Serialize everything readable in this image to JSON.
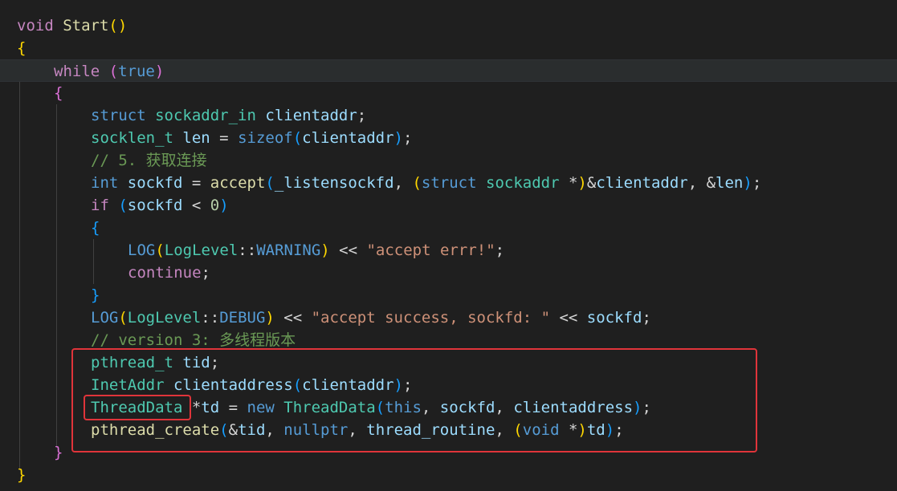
{
  "editor": {
    "theme_colors": {
      "background": "#1f1f1f",
      "current_line": "#2a2d2e",
      "highlight_box": "#e0343a"
    },
    "lines": [
      {
        "indent": 0,
        "tokens": [
          {
            "t": "void",
            "c": "control"
          },
          {
            "t": " ",
            "c": "plain"
          },
          {
            "t": "Start",
            "c": "func"
          },
          {
            "t": "()",
            "c": "brace1"
          }
        ]
      },
      {
        "indent": 0,
        "tokens": [
          {
            "t": "{",
            "c": "brace1"
          }
        ]
      },
      {
        "indent": 1,
        "current": true,
        "tokens": [
          {
            "t": "while",
            "c": "control"
          },
          {
            "t": " ",
            "c": "plain"
          },
          {
            "t": "(",
            "c": "brace2"
          },
          {
            "t": "true",
            "c": "keyword"
          },
          {
            "t": ")",
            "c": "brace2"
          }
        ]
      },
      {
        "indent": 1,
        "tokens": [
          {
            "t": "{",
            "c": "brace2"
          }
        ]
      },
      {
        "indent": 2,
        "tokens": [
          {
            "t": "struct",
            "c": "keyword"
          },
          {
            "t": " ",
            "c": "plain"
          },
          {
            "t": "sockaddr_in",
            "c": "type"
          },
          {
            "t": " ",
            "c": "plain"
          },
          {
            "t": "clientaddr",
            "c": "var"
          },
          {
            "t": ";",
            "c": "plain"
          }
        ]
      },
      {
        "indent": 2,
        "tokens": [
          {
            "t": "socklen_t",
            "c": "type"
          },
          {
            "t": " ",
            "c": "plain"
          },
          {
            "t": "len",
            "c": "var"
          },
          {
            "t": " = ",
            "c": "plain"
          },
          {
            "t": "sizeof",
            "c": "keyword"
          },
          {
            "t": "(",
            "c": "brace3"
          },
          {
            "t": "clientaddr",
            "c": "var"
          },
          {
            "t": ")",
            "c": "brace3"
          },
          {
            "t": ";",
            "c": "plain"
          }
        ]
      },
      {
        "indent": 2,
        "tokens": [
          {
            "t": "// 5. 获取连接",
            "c": "comment"
          }
        ]
      },
      {
        "indent": 2,
        "tokens": [
          {
            "t": "int",
            "c": "keyword"
          },
          {
            "t": " ",
            "c": "plain"
          },
          {
            "t": "sockfd",
            "c": "var"
          },
          {
            "t": " = ",
            "c": "plain"
          },
          {
            "t": "accept",
            "c": "func"
          },
          {
            "t": "(",
            "c": "brace3"
          },
          {
            "t": "_listensockfd",
            "c": "var"
          },
          {
            "t": ", ",
            "c": "plain"
          },
          {
            "t": "(",
            "c": "brace1"
          },
          {
            "t": "struct",
            "c": "keyword"
          },
          {
            "t": " ",
            "c": "plain"
          },
          {
            "t": "sockaddr",
            "c": "type"
          },
          {
            "t": " *",
            "c": "plain"
          },
          {
            "t": ")",
            "c": "brace1"
          },
          {
            "t": "&",
            "c": "plain"
          },
          {
            "t": "clientaddr",
            "c": "var"
          },
          {
            "t": ", &",
            "c": "plain"
          },
          {
            "t": "len",
            "c": "var"
          },
          {
            "t": ")",
            "c": "brace3"
          },
          {
            "t": ";",
            "c": "plain"
          }
        ]
      },
      {
        "indent": 2,
        "tokens": [
          {
            "t": "if",
            "c": "control"
          },
          {
            "t": " ",
            "c": "plain"
          },
          {
            "t": "(",
            "c": "brace3"
          },
          {
            "t": "sockfd",
            "c": "var"
          },
          {
            "t": " < ",
            "c": "plain"
          },
          {
            "t": "0",
            "c": "number"
          },
          {
            "t": ")",
            "c": "brace3"
          }
        ]
      },
      {
        "indent": 2,
        "tokens": [
          {
            "t": "{",
            "c": "brace3"
          }
        ]
      },
      {
        "indent": 3,
        "tokens": [
          {
            "t": "LOG",
            "c": "keyword"
          },
          {
            "t": "(",
            "c": "brace1"
          },
          {
            "t": "LogLevel",
            "c": "type"
          },
          {
            "t": "::",
            "c": "plain"
          },
          {
            "t": "WARNING",
            "c": "keyword"
          },
          {
            "t": ")",
            "c": "brace1"
          },
          {
            "t": " << ",
            "c": "plain"
          },
          {
            "t": "\"accept errr!\"",
            "c": "string"
          },
          {
            "t": ";",
            "c": "plain"
          }
        ]
      },
      {
        "indent": 3,
        "tokens": [
          {
            "t": "continue",
            "c": "control"
          },
          {
            "t": ";",
            "c": "plain"
          }
        ]
      },
      {
        "indent": 2,
        "tokens": [
          {
            "t": "}",
            "c": "brace3"
          }
        ]
      },
      {
        "indent": 2,
        "tokens": [
          {
            "t": "LOG",
            "c": "keyword"
          },
          {
            "t": "(",
            "c": "brace1"
          },
          {
            "t": "LogLevel",
            "c": "type"
          },
          {
            "t": "::",
            "c": "plain"
          },
          {
            "t": "DEBUG",
            "c": "keyword"
          },
          {
            "t": ")",
            "c": "brace1"
          },
          {
            "t": " << ",
            "c": "plain"
          },
          {
            "t": "\"accept success, sockfd: \"",
            "c": "string"
          },
          {
            "t": " << ",
            "c": "plain"
          },
          {
            "t": "sockfd",
            "c": "var"
          },
          {
            "t": ";",
            "c": "plain"
          }
        ]
      },
      {
        "indent": 2,
        "tokens": [
          {
            "t": "// version 3: 多线程版本",
            "c": "comment"
          }
        ]
      },
      {
        "indent": 2,
        "tokens": [
          {
            "t": "pthread_t",
            "c": "type"
          },
          {
            "t": " ",
            "c": "plain"
          },
          {
            "t": "tid",
            "c": "var"
          },
          {
            "t": ";",
            "c": "plain"
          }
        ]
      },
      {
        "indent": 2,
        "tokens": [
          {
            "t": "InetAddr",
            "c": "type"
          },
          {
            "t": " ",
            "c": "plain"
          },
          {
            "t": "clientaddress",
            "c": "var"
          },
          {
            "t": "(",
            "c": "brace3"
          },
          {
            "t": "clientaddr",
            "c": "var"
          },
          {
            "t": ")",
            "c": "brace3"
          },
          {
            "t": ";",
            "c": "plain"
          }
        ]
      },
      {
        "indent": 2,
        "tokens": [
          {
            "t": "ThreadData",
            "c": "type"
          },
          {
            "t": " *",
            "c": "plain"
          },
          {
            "t": "td",
            "c": "var"
          },
          {
            "t": " = ",
            "c": "plain"
          },
          {
            "t": "new",
            "c": "keyword"
          },
          {
            "t": " ",
            "c": "plain"
          },
          {
            "t": "ThreadData",
            "c": "type"
          },
          {
            "t": "(",
            "c": "brace3"
          },
          {
            "t": "this",
            "c": "keyword"
          },
          {
            "t": ", ",
            "c": "plain"
          },
          {
            "t": "sockfd",
            "c": "var"
          },
          {
            "t": ", ",
            "c": "plain"
          },
          {
            "t": "clientaddress",
            "c": "var"
          },
          {
            "t": ")",
            "c": "brace3"
          },
          {
            "t": ";",
            "c": "plain"
          }
        ]
      },
      {
        "indent": 2,
        "tokens": [
          {
            "t": "pthread_create",
            "c": "func"
          },
          {
            "t": "(",
            "c": "brace3"
          },
          {
            "t": "&",
            "c": "plain"
          },
          {
            "t": "tid",
            "c": "var"
          },
          {
            "t": ", ",
            "c": "plain"
          },
          {
            "t": "nullptr",
            "c": "keyword"
          },
          {
            "t": ", ",
            "c": "plain"
          },
          {
            "t": "thread_routine",
            "c": "var"
          },
          {
            "t": ", ",
            "c": "plain"
          },
          {
            "t": "(",
            "c": "brace1"
          },
          {
            "t": "void",
            "c": "keyword"
          },
          {
            "t": " *",
            "c": "plain"
          },
          {
            "t": ")",
            "c": "brace1"
          },
          {
            "t": "td",
            "c": "var"
          },
          {
            "t": ")",
            "c": "brace3"
          },
          {
            "t": ";",
            "c": "plain"
          }
        ]
      },
      {
        "indent": 1,
        "tokens": [
          {
            "t": "}",
            "c": "brace2"
          }
        ]
      },
      {
        "indent": 0,
        "tokens": [
          {
            "t": "}",
            "c": "brace1"
          }
        ]
      }
    ]
  }
}
